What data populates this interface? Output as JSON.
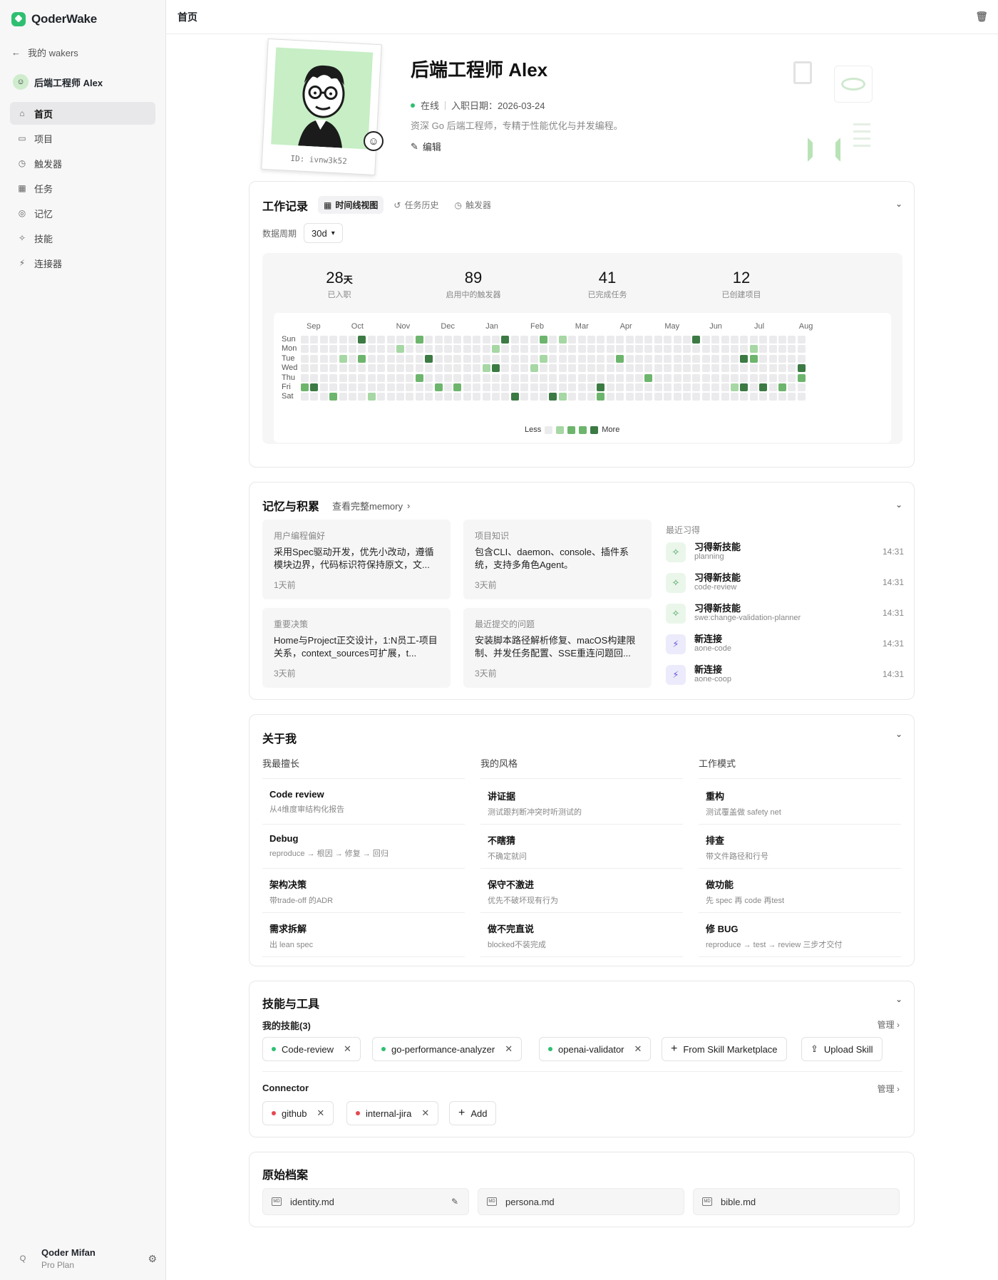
{
  "app": {
    "name": "QoderWake",
    "back_label": "我的 wakers",
    "agent_name": "后端工程师 Alex"
  },
  "nav": [
    {
      "label": "首页",
      "icon": "home-icon",
      "glyph": "⌂",
      "active": true
    },
    {
      "label": "项目",
      "icon": "projects-icon",
      "glyph": "▭"
    },
    {
      "label": "触发器",
      "icon": "clock-icon",
      "glyph": "◷"
    },
    {
      "label": "任务",
      "icon": "calendar-icon",
      "glyph": "▦"
    },
    {
      "label": "记忆",
      "icon": "memory-icon",
      "glyph": "◎"
    },
    {
      "label": "技能",
      "icon": "skill-icon",
      "glyph": "✧"
    },
    {
      "label": "连接器",
      "icon": "connector-icon",
      "glyph": "⚡"
    }
  ],
  "user": {
    "initial": "Q",
    "name": "Qoder Mifan",
    "plan": "Pro Plan"
  },
  "topbar": {
    "title": "首页"
  },
  "profile": {
    "name": "后端工程师 Alex",
    "id_text": "ID: ivnw3k52",
    "status": "在线",
    "join": "入职日期：2026-03-24",
    "desc": "资深 Go 后端工程师，专精于性能优化与并发编程。",
    "edit_label": "编辑"
  },
  "work": {
    "title": "工作记录",
    "tabs": [
      {
        "label": "时间线视图",
        "glyph": "▦",
        "active": true
      },
      {
        "label": "任务历史",
        "glyph": "↺"
      },
      {
        "label": "触发器",
        "glyph": "◷"
      }
    ],
    "period_label": "数据周期",
    "period_value": "30d",
    "stats": [
      {
        "num": "28",
        "unit": "天",
        "label": "已入职"
      },
      {
        "num": "89",
        "unit": "",
        "label": "启用中的触发器"
      },
      {
        "num": "41",
        "unit": "",
        "label": "已完成任务"
      },
      {
        "num": "12",
        "unit": "",
        "label": "已创建项目"
      }
    ],
    "months": [
      "Sep",
      "Oct",
      "Nov",
      "Dec",
      "Jan",
      "Feb",
      "Mar",
      "Apr",
      "May",
      "Jun",
      "Jul",
      "Aug"
    ],
    "days": [
      "Sun",
      "Mon",
      "Tue",
      "Wed",
      "Thu",
      "Fri",
      "Sat"
    ],
    "legend_less": "Less",
    "legend_more": "More",
    "heatmap_weeks": 53,
    "heatmap_cells": [
      [
        0,
        6,
        4
      ],
      [
        0,
        12,
        3
      ],
      [
        0,
        21,
        4
      ],
      [
        0,
        25,
        3
      ],
      [
        0,
        27,
        2
      ],
      [
        0,
        41,
        4
      ],
      [
        0,
        55,
        4
      ],
      [
        0,
        57,
        2
      ],
      [
        1,
        10,
        2
      ],
      [
        1,
        20,
        2
      ],
      [
        1,
        47,
        2
      ],
      [
        1,
        54,
        3
      ],
      [
        1,
        68,
        2
      ],
      [
        1,
        82,
        2
      ],
      [
        2,
        4,
        2
      ],
      [
        2,
        6,
        3
      ],
      [
        2,
        13,
        4
      ],
      [
        2,
        25,
        2
      ],
      [
        2,
        33,
        3
      ],
      [
        2,
        46,
        4
      ],
      [
        2,
        47,
        3
      ],
      [
        2,
        61,
        3
      ],
      [
        3,
        19,
        2
      ],
      [
        3,
        20,
        4
      ],
      [
        3,
        24,
        2
      ],
      [
        3,
        52,
        4
      ],
      [
        4,
        12,
        3
      ],
      [
        4,
        36,
        3
      ],
      [
        4,
        52,
        3
      ],
      [
        5,
        0,
        3
      ],
      [
        5,
        1,
        4
      ],
      [
        5,
        14,
        3
      ],
      [
        5,
        16,
        3
      ],
      [
        5,
        31,
        4
      ],
      [
        5,
        45,
        2
      ],
      [
        5,
        46,
        4
      ],
      [
        5,
        48,
        4
      ],
      [
        5,
        50,
        3
      ],
      [
        6,
        3,
        3
      ],
      [
        6,
        7,
        2
      ],
      [
        6,
        22,
        4
      ],
      [
        6,
        26,
        4
      ],
      [
        6,
        27,
        2
      ],
      [
        6,
        31,
        3
      ]
    ]
  },
  "memory": {
    "title": "记忆与积累",
    "view_all": "查看完整memory",
    "boxes": [
      {
        "head": "用户编程偏好",
        "text": "采用Spec驱动开发，优先小改动，遵循模块边界，代码标识符保持原文，文...",
        "date": "1天前"
      },
      {
        "head": "项目知识",
        "text": "包含CLI、daemon、console、插件系统，支持多角色Agent。",
        "date": "3天前"
      },
      {
        "head": "重要决策",
        "text": "Home与Project正交设计，1:N员工-项目关系，context_sources可扩展，t...",
        "date": "3天前"
      },
      {
        "head": "最近提交的问题",
        "text": "安装脚本路径解析修复、macOS构建限制、并发任务配置、SSE重连问题回...",
        "date": "3天前"
      }
    ],
    "recent_title": "最近习得",
    "recent": [
      {
        "title": "习得新技能",
        "sub": "planning",
        "time": "14:31",
        "kind": "skill"
      },
      {
        "title": "习得新技能",
        "sub": "code-review",
        "time": "14:31",
        "kind": "skill"
      },
      {
        "title": "习得新技能",
        "sub": "swe:change-validation-planner",
        "time": "14:31",
        "kind": "skill"
      },
      {
        "title": "新连接",
        "sub": "aone-code",
        "time": "14:31",
        "kind": "connector"
      },
      {
        "title": "新连接",
        "sub": "aone-coop",
        "time": "14:31",
        "kind": "connector"
      }
    ]
  },
  "about": {
    "title": "关于我",
    "columns": [
      {
        "head": "我最擅长",
        "items": [
          {
            "t": "Code review",
            "s": "从4维度审结构化报告"
          },
          {
            "t": "Debug",
            "s": "reproduce → 根因 → 修复 → 回归"
          },
          {
            "t": "架构决策",
            "s": "带trade-off 的ADR"
          },
          {
            "t": "需求拆解",
            "s": "出 lean spec"
          }
        ]
      },
      {
        "head": "我的风格",
        "items": [
          {
            "t": "讲证据",
            "s": "测试跟判断冲突时听测试的"
          },
          {
            "t": "不瞎猜",
            "s": "不确定就问"
          },
          {
            "t": "保守不激进",
            "s": "优先不破坏现有行为"
          },
          {
            "t": "做不完直说",
            "s": "blocked不装完成"
          }
        ]
      },
      {
        "head": "工作模式",
        "items": [
          {
            "t": "重构",
            "s": "测试覆盖做 safety net"
          },
          {
            "t": "排查",
            "s": "带文件路径和行号"
          },
          {
            "t": "做功能",
            "s": "先 spec 再 code 再test"
          },
          {
            "t": "修 BUG",
            "s": "reproduce → test → review 三步才交付"
          }
        ]
      }
    ]
  },
  "skills": {
    "title": "技能与工具",
    "my_skills": "我的技能(3)",
    "manage": "管理",
    "chips": [
      {
        "label": "Code-review",
        "color": "#2fbf71"
      },
      {
        "label": "go-performance-analyzer",
        "color": "#2fbf71"
      },
      {
        "label": "openai-validator",
        "color": "#2fbf71"
      }
    ],
    "marketplace": "From Skill Marketplace",
    "upload": "Upload Skill",
    "connector_label": "Connector",
    "connectors": [
      {
        "label": "github",
        "color": "#e5484d"
      },
      {
        "label": "internal-jira",
        "color": "#e5484d"
      }
    ],
    "add": "Add"
  },
  "files": {
    "title": "原始档案",
    "items": [
      "identity.md",
      "persona.md",
      "bible.md"
    ],
    "md_tag": "MD"
  }
}
